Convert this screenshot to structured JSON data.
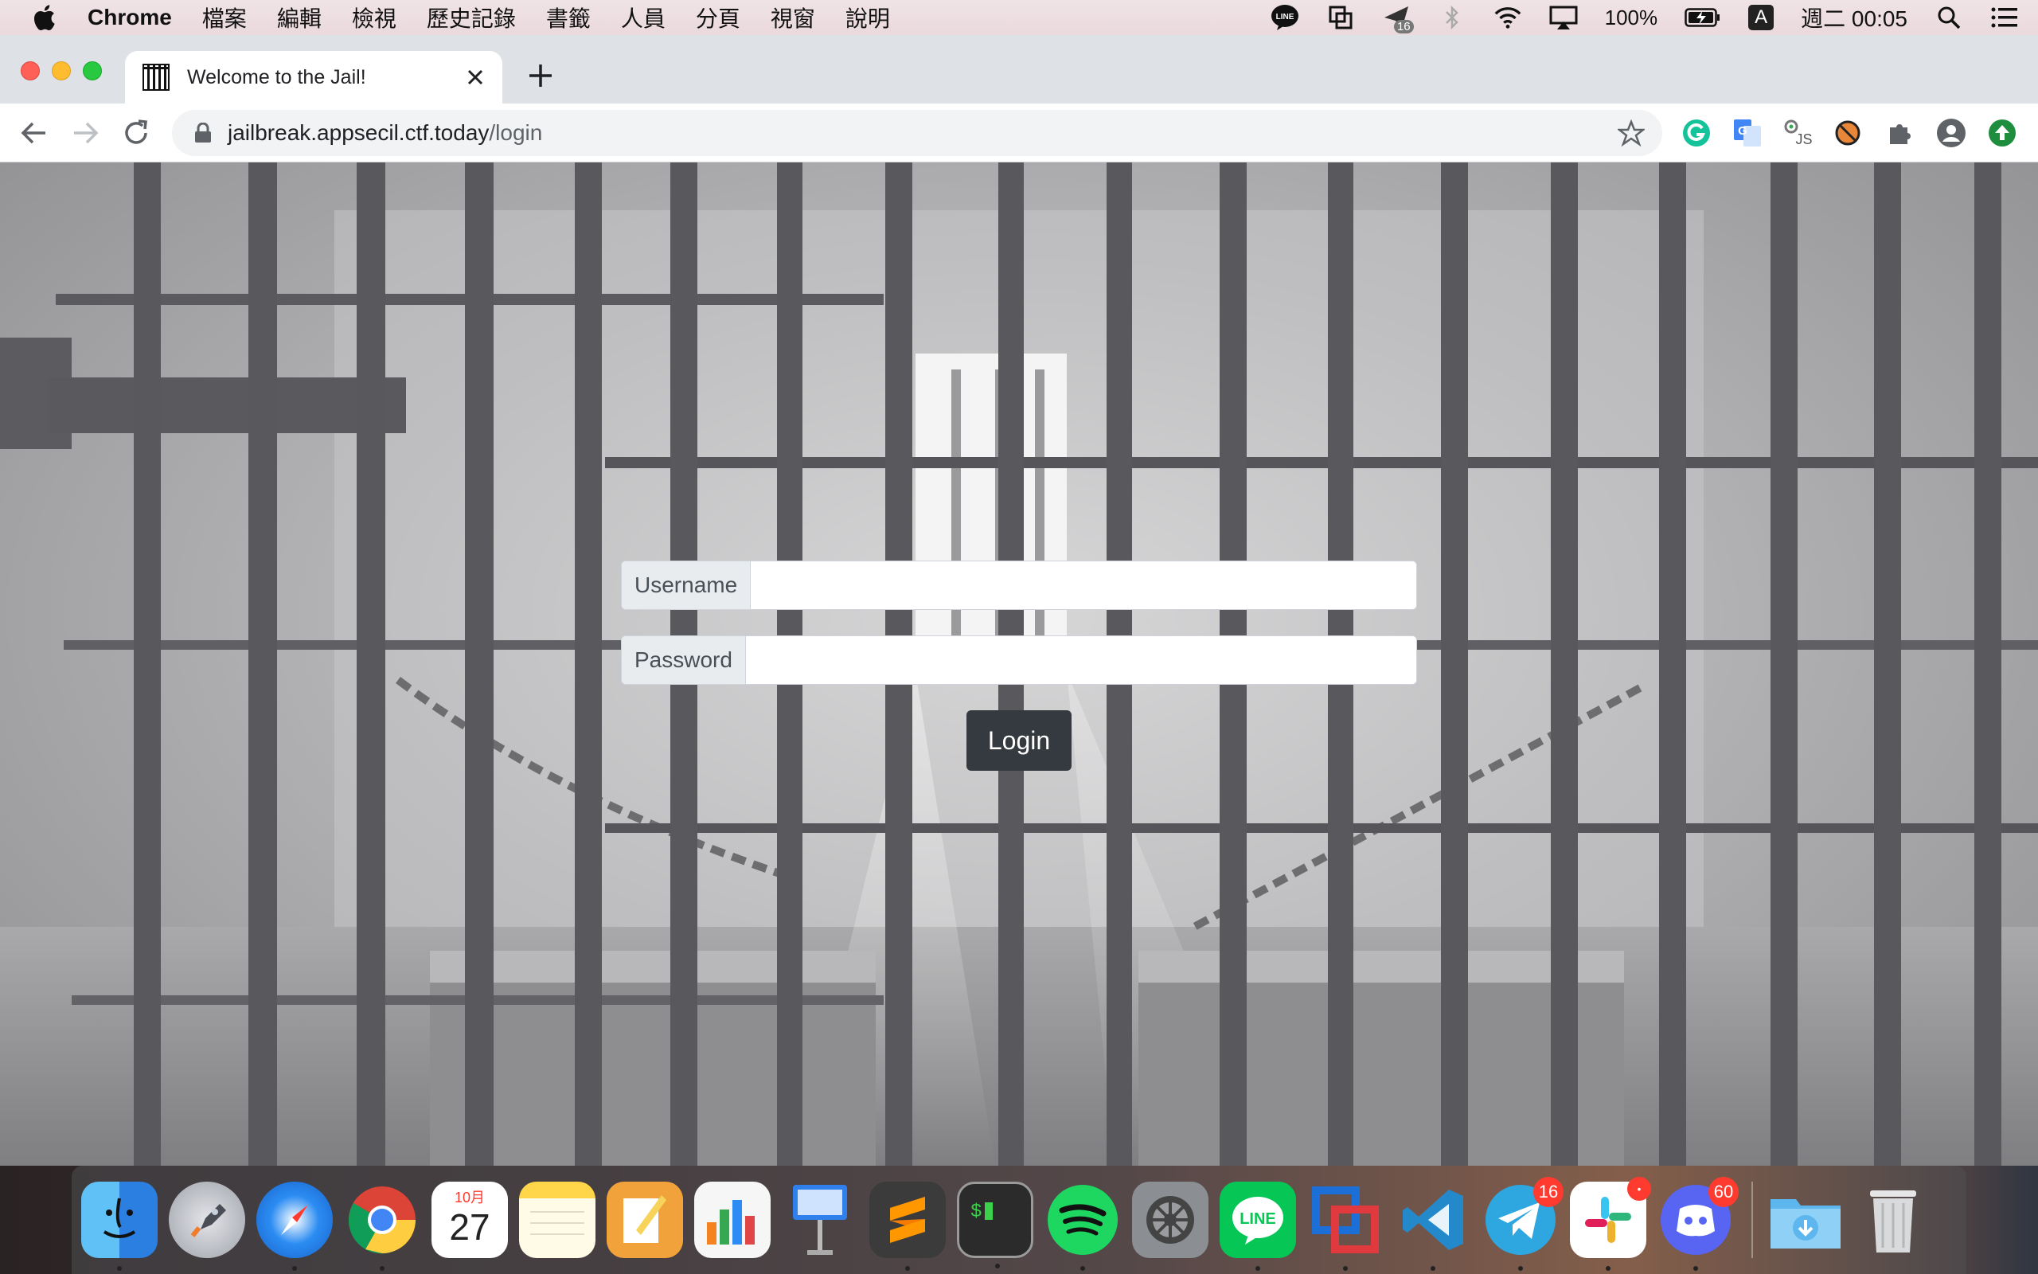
{
  "menubar": {
    "app_name": "Chrome",
    "items": [
      "檔案",
      "編輯",
      "檢視",
      "歷史記錄",
      "書籤",
      "人員",
      "分頁",
      "視窗",
      "說明"
    ],
    "battery": "100%",
    "input_method": "A",
    "clock": "週二 00:05",
    "notification_badge": "16"
  },
  "browser": {
    "tab_title": "Welcome to the Jail!",
    "url_host": "jailbreak.appsecil.ctf.today",
    "url_path": "/login"
  },
  "login_form": {
    "username_label": "Username",
    "username_value": "",
    "password_label": "Password",
    "password_value": "",
    "submit_label": "Login"
  },
  "dock": {
    "calendar_month": "10月",
    "calendar_day": "27",
    "telegram_badge": "16",
    "discord_badge": "60",
    "apps": [
      "finder",
      "launchpad",
      "safari",
      "chrome",
      "calendar",
      "notes",
      "pages",
      "numbers",
      "keynote",
      "sublime-text",
      "terminal",
      "spotify",
      "system-preferences",
      "line",
      "vmware",
      "vscode",
      "telegram",
      "slack",
      "discord",
      "downloads",
      "trash"
    ]
  }
}
